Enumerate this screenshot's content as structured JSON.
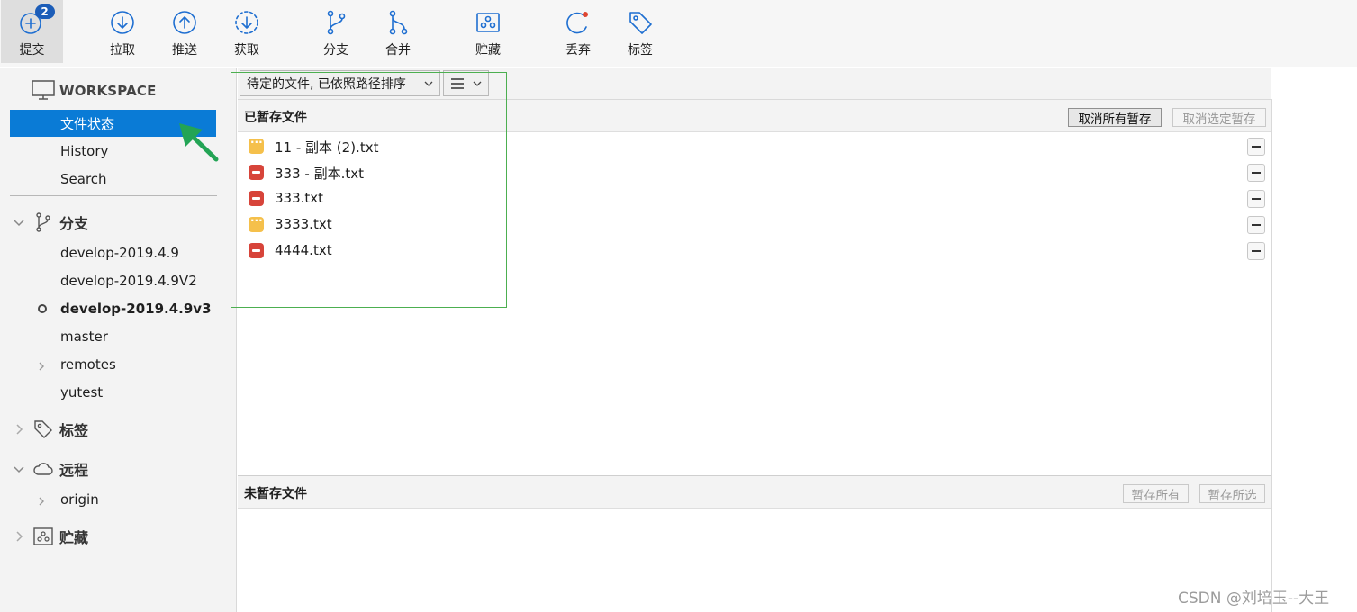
{
  "toolbar": {
    "commit": {
      "label": "提交",
      "badge": "2"
    },
    "pull": {
      "label": "拉取"
    },
    "push": {
      "label": "推送"
    },
    "fetch": {
      "label": "获取"
    },
    "branch": {
      "label": "分支"
    },
    "merge": {
      "label": "合并"
    },
    "stash": {
      "label": "贮藏"
    },
    "discard": {
      "label": "丢弃"
    },
    "tag": {
      "label": "标签"
    }
  },
  "sidebar": {
    "workspace": {
      "title": "WORKSPACE",
      "items": [
        "文件状态",
        "History",
        "Search"
      ],
      "selected": "文件状态"
    },
    "branches": {
      "title": "分支",
      "items": [
        "develop-2019.4.9",
        "develop-2019.4.9V2",
        "develop-2019.4.9v3",
        "master",
        "remotes",
        "yutest"
      ],
      "current": "develop-2019.4.9v3"
    },
    "tags": {
      "title": "标签"
    },
    "remotes": {
      "title": "远程",
      "items": [
        "origin"
      ]
    },
    "stashes": {
      "title": "贮藏"
    }
  },
  "filter": {
    "sort_label": "待定的文件, 已依照路径排序"
  },
  "staged": {
    "title": "已暂存文件",
    "unstage_all": "取消所有暂存",
    "unstage_selected": "取消选定暂存",
    "files": [
      {
        "name": "11 - 副本 (2).txt",
        "status": "modified"
      },
      {
        "name": "333 - 副本.txt",
        "status": "deleted"
      },
      {
        "name": "333.txt",
        "status": "deleted"
      },
      {
        "name": "3333.txt",
        "status": "modified"
      },
      {
        "name": "4444.txt",
        "status": "deleted"
      }
    ]
  },
  "unstaged": {
    "title": "未暂存文件",
    "stage_all": "暂存所有",
    "stage_selected": "暂存所选"
  },
  "watermark": "CSDN @刘培玉--大王",
  "colors": {
    "accent": "#0a7bd6",
    "icon_blue": "#1f6fd1",
    "modified": "#f5c04b",
    "deleted": "#d7443a",
    "badge": "#1c5db8",
    "annotation": "#4caf50",
    "arrow": "#23a455"
  }
}
